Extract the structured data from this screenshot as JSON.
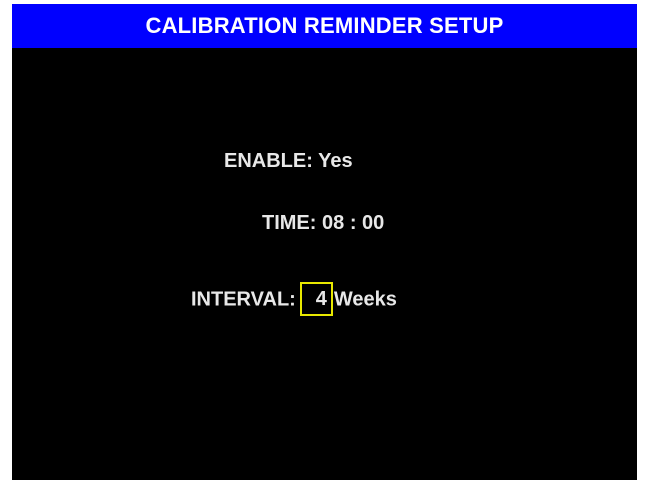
{
  "window": {
    "title": "CALIBRATION REMINDER SETUP"
  },
  "settings": {
    "enable": {
      "label": "ENABLE:",
      "value": "Yes"
    },
    "time": {
      "label": "TIME:",
      "hours": "08",
      "separator": ":",
      "minutes": "00"
    },
    "interval": {
      "label": "INTERVAL:",
      "value": "4",
      "unit": "Weeks"
    }
  },
  "colors": {
    "title_bar": "#0000ff",
    "screen_background": "#000000",
    "text": "#e8e8e8",
    "focus_box": "#e8e800"
  }
}
